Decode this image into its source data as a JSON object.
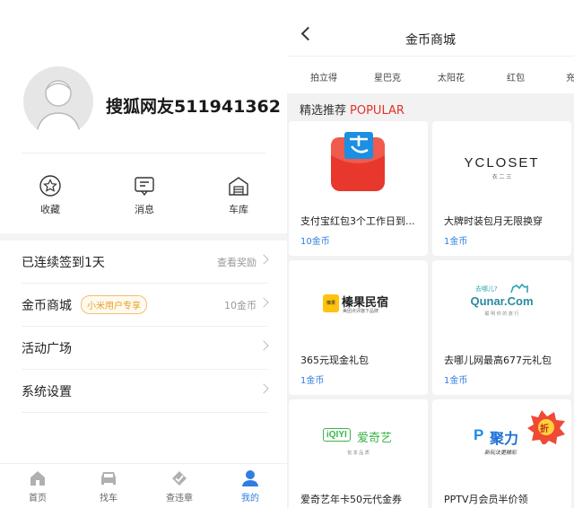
{
  "profile": {
    "username": "搜狐网友511941362"
  },
  "quick_actions": [
    {
      "label": "收藏",
      "icon": "star-icon"
    },
    {
      "label": "消息",
      "icon": "message-icon"
    },
    {
      "label": "车库",
      "icon": "garage-icon"
    }
  ],
  "menu": {
    "signin": {
      "label": "已连续签到1天",
      "right": "查看奖励"
    },
    "mall": {
      "label": "金币商城",
      "badge": "小米用户专享",
      "right": "10金币"
    },
    "activity": {
      "label": "活动广场"
    },
    "settings": {
      "label": "系统设置"
    }
  },
  "tabbar": [
    {
      "label": "首页",
      "icon": "home-icon"
    },
    {
      "label": "找车",
      "icon": "car-icon"
    },
    {
      "label": "查违章",
      "icon": "violation-icon"
    },
    {
      "label": "我的",
      "icon": "profile-icon",
      "active": true
    }
  ],
  "mall_page": {
    "title": "金币商城",
    "categories": [
      "拍立得",
      "星巴克",
      "太阳花",
      "红包",
      "充"
    ],
    "section_title": "精选推荐",
    "section_tag": "POPULAR",
    "items": [
      {
        "name": "支付宝红包3个工作日到...",
        "price": "10金币",
        "brand": "alipay"
      },
      {
        "name": "大牌时装包月无限换穿",
        "price": "1金币",
        "brand": "YCLOSET",
        "brand_sub": "衣 二 三"
      },
      {
        "name": "365元现金礼包",
        "price": "1金币",
        "brand": "榛果民宿",
        "brand_sub": "美团点评旗下品牌"
      },
      {
        "name": "去哪儿网最高677元礼包",
        "price": "1金币",
        "brand": "Qunar.Com",
        "brand_sub": "聪 明 你 的 旅 行",
        "brand_top": "去哪儿?"
      },
      {
        "name": "爱奇艺年卡50元代金券",
        "price": "",
        "brand": "爱奇艺",
        "brand_logo": "iQIYI",
        "brand_sub": "悦 享 品 质"
      },
      {
        "name": "PPTV月会员半价领",
        "price": "",
        "brand": "聚力",
        "brand_sub": "新玩法更精彩",
        "brand_badge": "折"
      }
    ]
  },
  "colors": {
    "accent": "#2f7de1",
    "popular": "#e2332a",
    "badge": "#e8a028"
  }
}
